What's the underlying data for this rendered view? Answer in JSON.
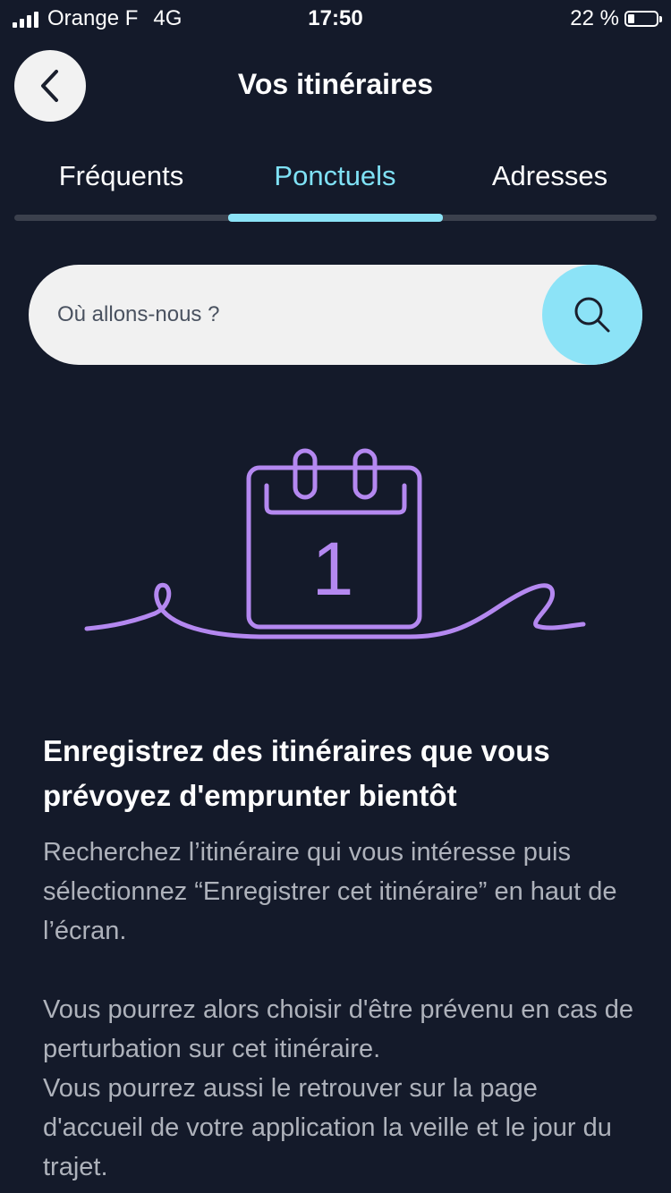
{
  "status_bar": {
    "carrier": "Orange F",
    "network": "4G",
    "time": "17:50",
    "battery": "22 %",
    "battery_level": 0.22
  },
  "header": {
    "title": "Vos itinéraires",
    "back_icon": "chevron-left-icon"
  },
  "tabs": [
    {
      "label": "Fréquents",
      "active": false
    },
    {
      "label": "Ponctuels",
      "active": true
    },
    {
      "label": "Adresses",
      "active": false
    }
  ],
  "search": {
    "placeholder": "Où allons-nous ?",
    "value": "",
    "icon": "search-icon"
  },
  "illustration": {
    "icon": "calendar-icon",
    "day_number": "1"
  },
  "empty_state": {
    "heading": "Enregistrez des itinéraires que vous prévoyez d'emprunter bientôt",
    "paragraph_1": "Recherchez l’itinéraire qui vous intéresse puis sélectionnez “Enregistrer cet itinéraire” en haut de l’écran.",
    "paragraph_2a": "Vous pourrez alors choisir d'être prévenu en cas de perturbation sur cet itinéraire.",
    "paragraph_2b": "Vous pourrez aussi le retrouver sur la page d'accueil de votre application la veille et le jour du trajet."
  },
  "colors": {
    "background": "#141a2a",
    "accent": "#8ce3f7",
    "illustration": "#b488f0",
    "muted_text": "#aeb2bb"
  }
}
